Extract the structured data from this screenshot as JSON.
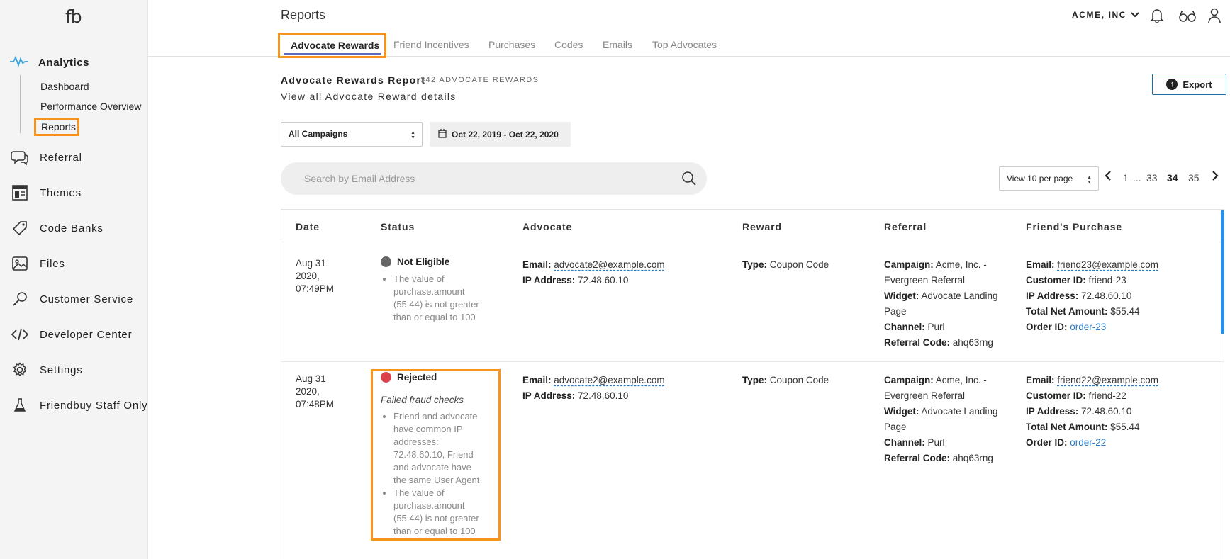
{
  "brand": {
    "logo": "fb"
  },
  "sidebar": {
    "analytics": "Analytics",
    "sub": [
      "Dashboard",
      "Performance Overview",
      "Reports"
    ],
    "items": [
      {
        "label": "Referral",
        "icon": "chat-icon"
      },
      {
        "label": "Themes",
        "icon": "layout-icon"
      },
      {
        "label": "Code Banks",
        "icon": "tag-icon"
      },
      {
        "label": "Files",
        "icon": "image-icon"
      },
      {
        "label": "Customer Service",
        "icon": "key-icon"
      },
      {
        "label": "Developer Center",
        "icon": "code-icon"
      },
      {
        "label": "Settings",
        "icon": "gear-icon"
      },
      {
        "label": "Friendbuy Staff Only",
        "icon": "flask-icon"
      }
    ]
  },
  "header": {
    "title": "Reports",
    "account": "ACME, INC",
    "tabs": [
      "Advocate Rewards",
      "Friend Incentives",
      "Purchases",
      "Codes",
      "Emails",
      "Top Advocates"
    ]
  },
  "report": {
    "title": "Advocate Rewards Report",
    "count": "342 ADVOCATE REWARDS",
    "subtitle": "View all Advocate Reward details",
    "export": "Export",
    "campaign": "All Campaigns",
    "date_range": "Oct 22, 2019 - Oct 22, 2020",
    "search_placeholder": "Search by Email Address",
    "per_page": "View 10 per page",
    "pages": [
      "1",
      "...",
      "33",
      "34",
      "35"
    ]
  },
  "table": {
    "headers": [
      "Date",
      "Status",
      "Advocate",
      "Reward",
      "Referral",
      "Friend's Purchase"
    ],
    "labels": {
      "email": "Email:",
      "ip": "IP Address:",
      "type": "Type:",
      "campaign": "Campaign:",
      "widget": "Widget:",
      "channel": "Channel:",
      "code": "Referral Code:",
      "customer": "Customer ID:",
      "net": "Total Net Amount:",
      "order": "Order ID:"
    },
    "rows": [
      {
        "date": [
          "Aug 31",
          "2020,",
          "07:49PM"
        ],
        "status": "Not Eligible",
        "status_color": "#666666",
        "fraud": "",
        "reasons": [
          "The value of purchase.amount (55.44) is not greater than or equal to 100"
        ],
        "adv_email": "advocate2@example.com",
        "adv_ip": "72.48.60.10",
        "reward_type": "Coupon Code",
        "campaign": "Acme, Inc. - Evergreen Referral",
        "widget": "Advocate Landing Page",
        "channel": "Purl",
        "ref_code": "ahq63rng",
        "f_email": "friend23@example.com",
        "f_customer": "friend-23",
        "f_ip": "72.48.60.10",
        "f_net": "$55.44",
        "f_order": "order-23"
      },
      {
        "date": [
          "Aug 31",
          "2020,",
          "07:48PM"
        ],
        "status": "Rejected",
        "status_color": "#d9404a",
        "fraud": "Failed fraud checks",
        "reasons": [
          "Friend and advocate have common IP addresses: 72.48.60.10, Friend and advocate have the same User Agent",
          "The value of purchase.amount (55.44) is not greater than or equal to 100"
        ],
        "adv_email": "advocate2@example.com",
        "adv_ip": "72.48.60.10",
        "reward_type": "Coupon Code",
        "campaign": "Acme, Inc. - Evergreen Referral",
        "widget": "Advocate Landing Page",
        "channel": "Purl",
        "ref_code": "ahq63rng",
        "f_email": "friend22@example.com",
        "f_customer": "friend-22",
        "f_ip": "72.48.60.10",
        "f_net": "$55.44",
        "f_order": "order-22"
      }
    ]
  },
  "colors": {
    "accent": "#f7941d",
    "link": "#2a7bc4",
    "tab_underline": "#5b6bc0"
  }
}
